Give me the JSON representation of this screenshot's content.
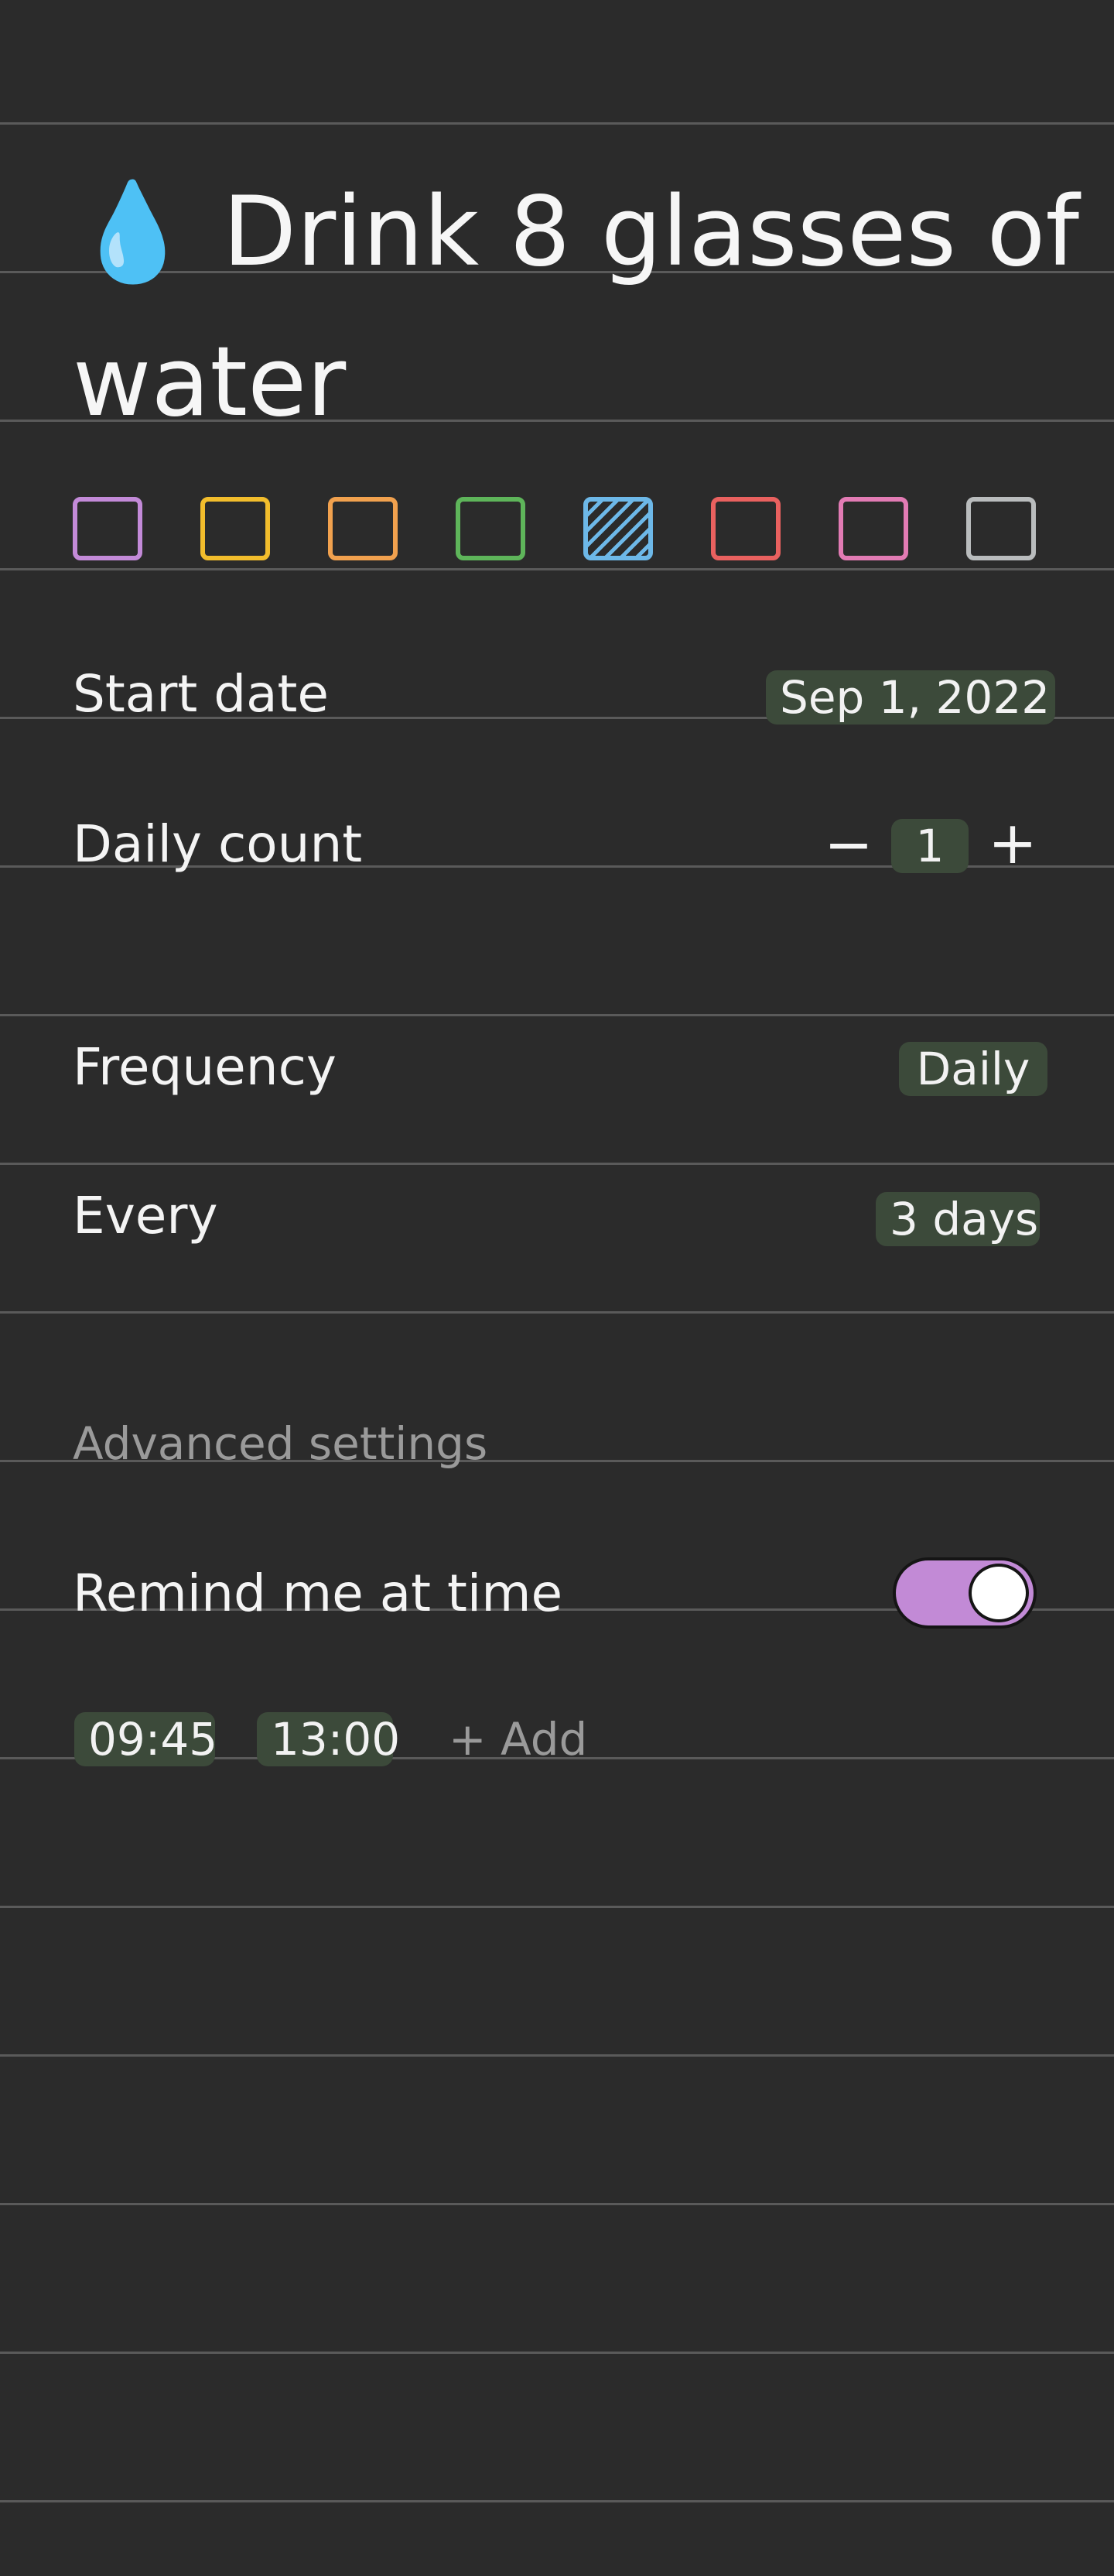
{
  "habit": {
    "icon": "water-drop-icon",
    "title_line1": "💧 Drink 8 glasses of",
    "title_line2": "water"
  },
  "colors": [
    {
      "name": "purple",
      "hex": "#c38ad8",
      "selected": false
    },
    {
      "name": "yellow",
      "hex": "#f2bd2c",
      "selected": false
    },
    {
      "name": "orange",
      "hex": "#f1a14e",
      "selected": false
    },
    {
      "name": "green",
      "hex": "#5eb55a",
      "selected": false
    },
    {
      "name": "blue",
      "hex": "#6db8e8",
      "selected": true
    },
    {
      "name": "red",
      "hex": "#e9615f",
      "selected": false
    },
    {
      "name": "pink",
      "hex": "#e27bb4",
      "selected": false
    },
    {
      "name": "gray",
      "hex": "#b9bcbd",
      "selected": false
    }
  ],
  "start_date": {
    "label": "Start date",
    "value": "Sep 1, 2022"
  },
  "daily_count": {
    "label": "Daily count",
    "decrement": "−",
    "value": "1",
    "increment": "+"
  },
  "frequency": {
    "label": "Frequency",
    "value": "Daily"
  },
  "every": {
    "label": "Every",
    "value": "3 days"
  },
  "advanced": {
    "heading": "Advanced settings",
    "remind_label": "Remind me at time",
    "remind_enabled": true,
    "times": [
      "09:45",
      "13:00"
    ],
    "add_label": "+ Add"
  },
  "theme": {
    "background": "#2b2b2b",
    "chip": "#3c4a3a",
    "toggle_on": "#c28ad6"
  }
}
